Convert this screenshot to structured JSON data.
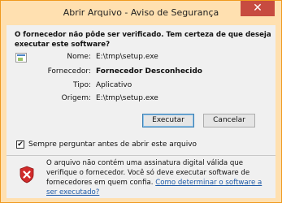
{
  "window": {
    "title": "Abrir Arquivo - Aviso de Segurança",
    "close_glyph": "✕"
  },
  "question": "O fornecedor não pôde ser verificado. Tem certeza de que deseja executar este software?",
  "properties": {
    "name_label": "Nome:",
    "name_value": "E:\\tmp\\setup.exe",
    "publisher_label": "Fornecedor:",
    "publisher_value": "Fornecedor Desconhecido",
    "type_label": "Tipo:",
    "type_value": "Aplicativo",
    "origin_label": "Origem:",
    "origin_value": "E:\\tmp\\setup.exe"
  },
  "buttons": {
    "execute": "Executar",
    "cancel": "Cancelar"
  },
  "checkbox": {
    "checked": true,
    "mark": "✔",
    "label": "Sempre perguntar antes de abrir este arquivo"
  },
  "warning": {
    "text": "O arquivo não contém uma assinatura digital válida que verifique o fornecedor. Você só deve executar software de fornecedores em quem confia.",
    "link": "Como determinar o software a ser executado?"
  },
  "colors": {
    "frame": "#ffe0b0",
    "close": "#c74b40",
    "link": "#1f5ba8",
    "shield": "#d12b2b"
  }
}
